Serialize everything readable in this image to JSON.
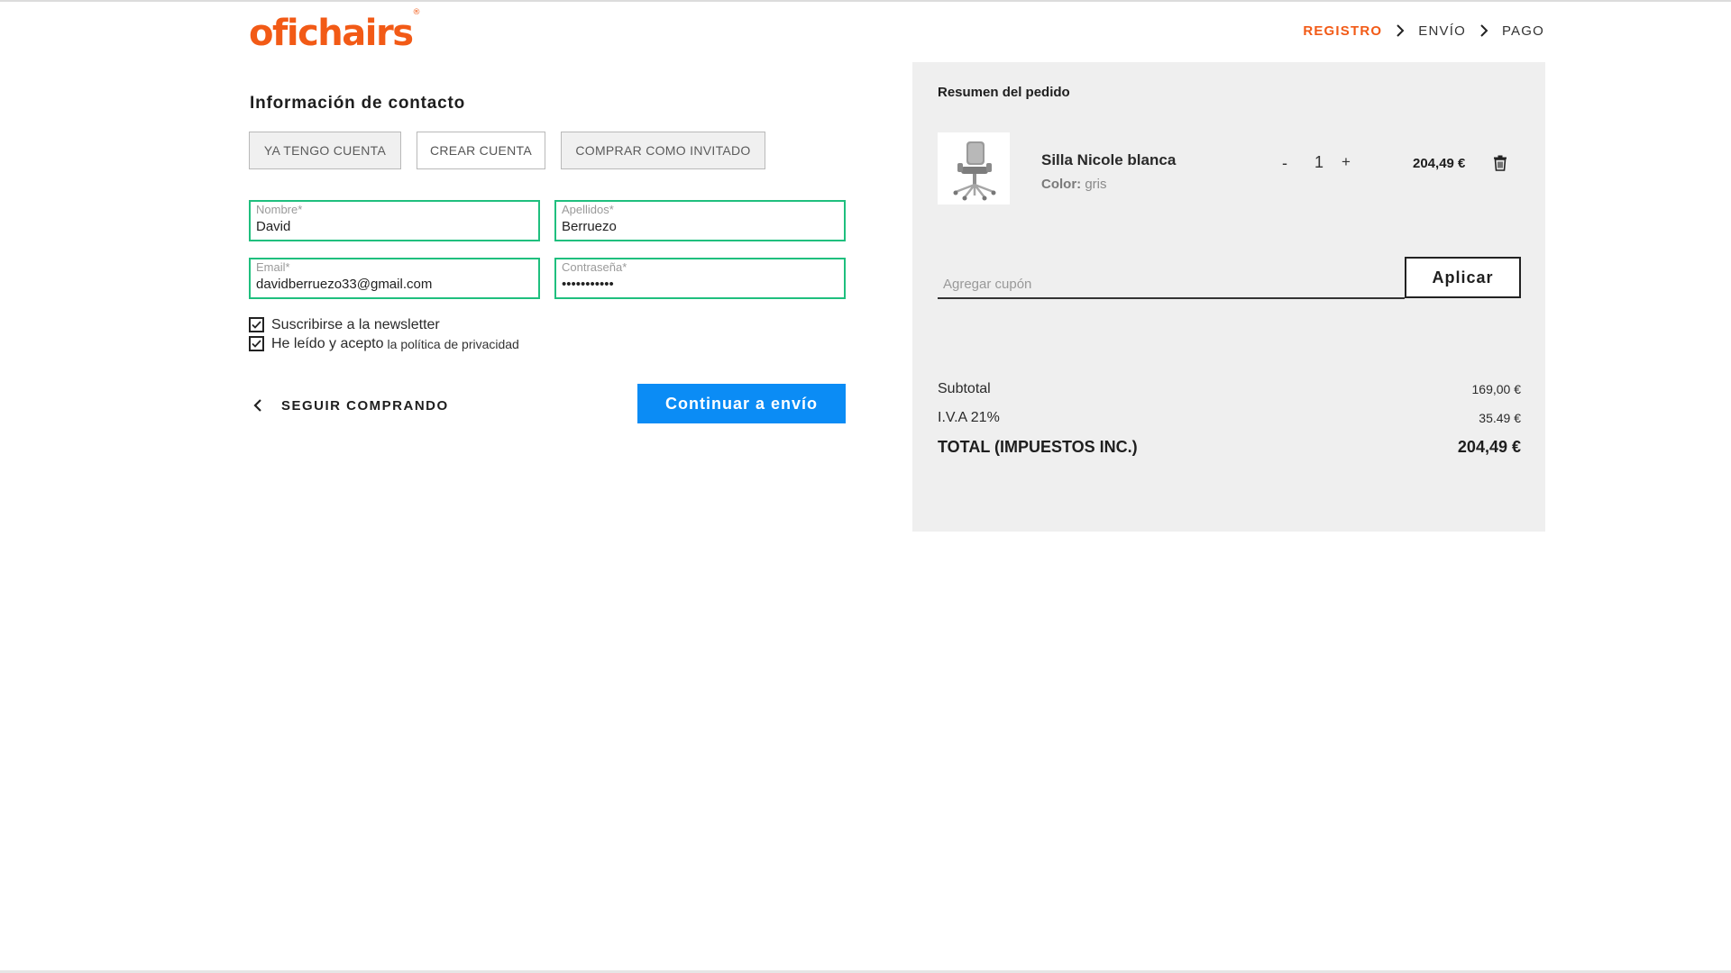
{
  "header": {
    "logo_text": "oficha irs",
    "logo": "oficha",
    "logo_rest": "irs",
    "logo_mark": "®",
    "steps": [
      "REGISTRO",
      "ENVÍO",
      "PAGO"
    ],
    "active_step": "REGISTRO"
  },
  "contact": {
    "title": "Información de contacto",
    "tabs": [
      "YA TENGO CUENTA",
      "CREAR CUENTA",
      "COMPRAR COMO INVITADO"
    ],
    "fields": {
      "nombre": {
        "label": "Nombre*",
        "value": "David"
      },
      "apellidos": {
        "label": "Apellidos*",
        "value": "Berruezo"
      },
      "email": {
        "label": "Email*",
        "value": "davidberruezo33@gmail.com"
      },
      "password": {
        "label": "Contraseña*",
        "value": "•••••••••••"
      }
    },
    "newsletter_label": "Suscribirse a la newsletter",
    "privacy_label": "He leído y acepto",
    "privacy_link": "la política de privacidad",
    "newsletter_checked": true,
    "privacy_checked": true,
    "back_label": "SEGUIR COMPRANDO",
    "continue_label": "Continuar a envío"
  },
  "summary": {
    "title": "Resumen del pedido",
    "product": {
      "name": "Silla Nicole blanca",
      "attr_label": "Color:",
      "attr_value": "gris",
      "qty_minus": "-",
      "qty": "1",
      "qty_plus": "+",
      "price": "204,49 €"
    },
    "coupon_placeholder": "Agregar cupón",
    "apply_label": "Aplicar",
    "subtotal_label": "Subtotal",
    "subtotal_value": "169,00 €",
    "iva_label": "I.V.A 21%",
    "iva_value": "35.49 €",
    "total_label": "TOTAL (IMPUESTOS INC.)",
    "total_value": "204,49 €"
  },
  "colors": {
    "accent": "#f25a16",
    "cta": "#0b8cf5",
    "field_border": "#1fbf7e",
    "summary_bg": "#efefef"
  }
}
